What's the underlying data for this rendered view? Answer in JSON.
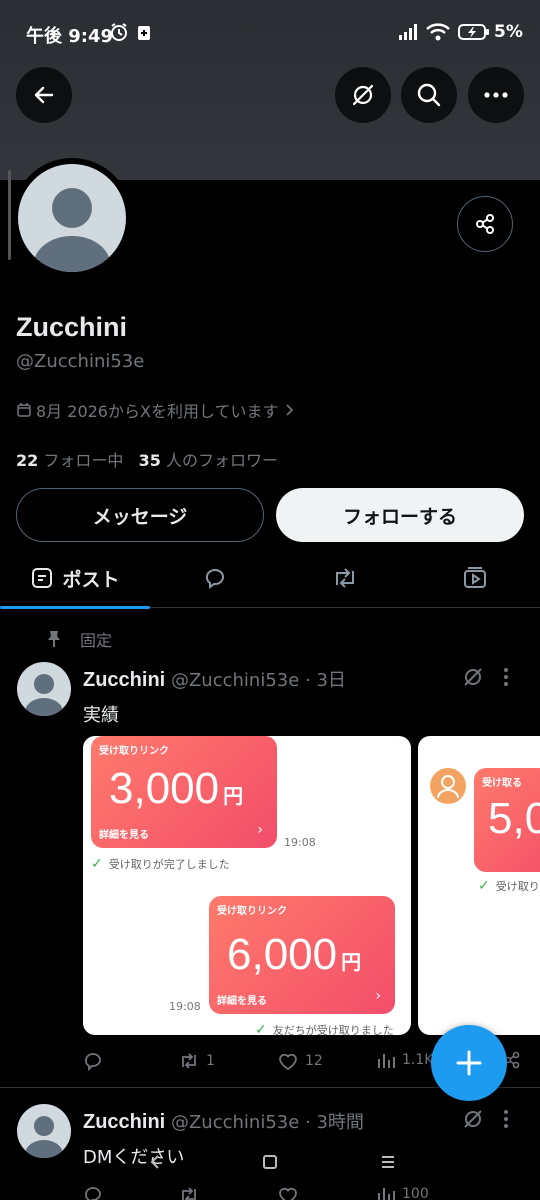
{
  "status": {
    "time": "午後 9:49",
    "battery": "5%"
  },
  "profile": {
    "name": "Zucchini",
    "handle": "@Zucchini53e",
    "joined": "8月 2026からXを利用しています",
    "following_count": "22",
    "following_label": "フォロー中",
    "followers_count": "35",
    "followers_label": "人のフォロワー"
  },
  "buttons": {
    "message": "メッセージ",
    "follow": "フォローする"
  },
  "tabs": {
    "posts": "ポスト"
  },
  "pinned_label": "固定",
  "tweets": [
    {
      "name": "Zucchini",
      "meta": "@Zucchini53e · 3日",
      "text": "実績",
      "replies": "",
      "retweets": "1",
      "likes": "12",
      "views": "1.1K",
      "media": {
        "card1": {
          "title": "受け取りリンク",
          "amount": "3,000",
          "yen": "円",
          "more": "詳細を見る",
          "time": "19:08",
          "status": "受け取りが完了しました"
        },
        "card2": {
          "title": "受け取りリンク",
          "amount": "6,000",
          "yen": "円",
          "more": "詳細を見る",
          "time": "19:08",
          "status": "友だちが受け取りました"
        },
        "card3": {
          "title": "受け取る",
          "amount": "5,0",
          "status": "受け取りが"
        }
      }
    },
    {
      "name": "Zucchini",
      "meta": "@Zucchini53e · 3時間",
      "text": "DMください",
      "views": "100"
    }
  ],
  "colors": {
    "accent": "#1d9bf0",
    "bg": "#000000",
    "muted": "#71767b"
  }
}
